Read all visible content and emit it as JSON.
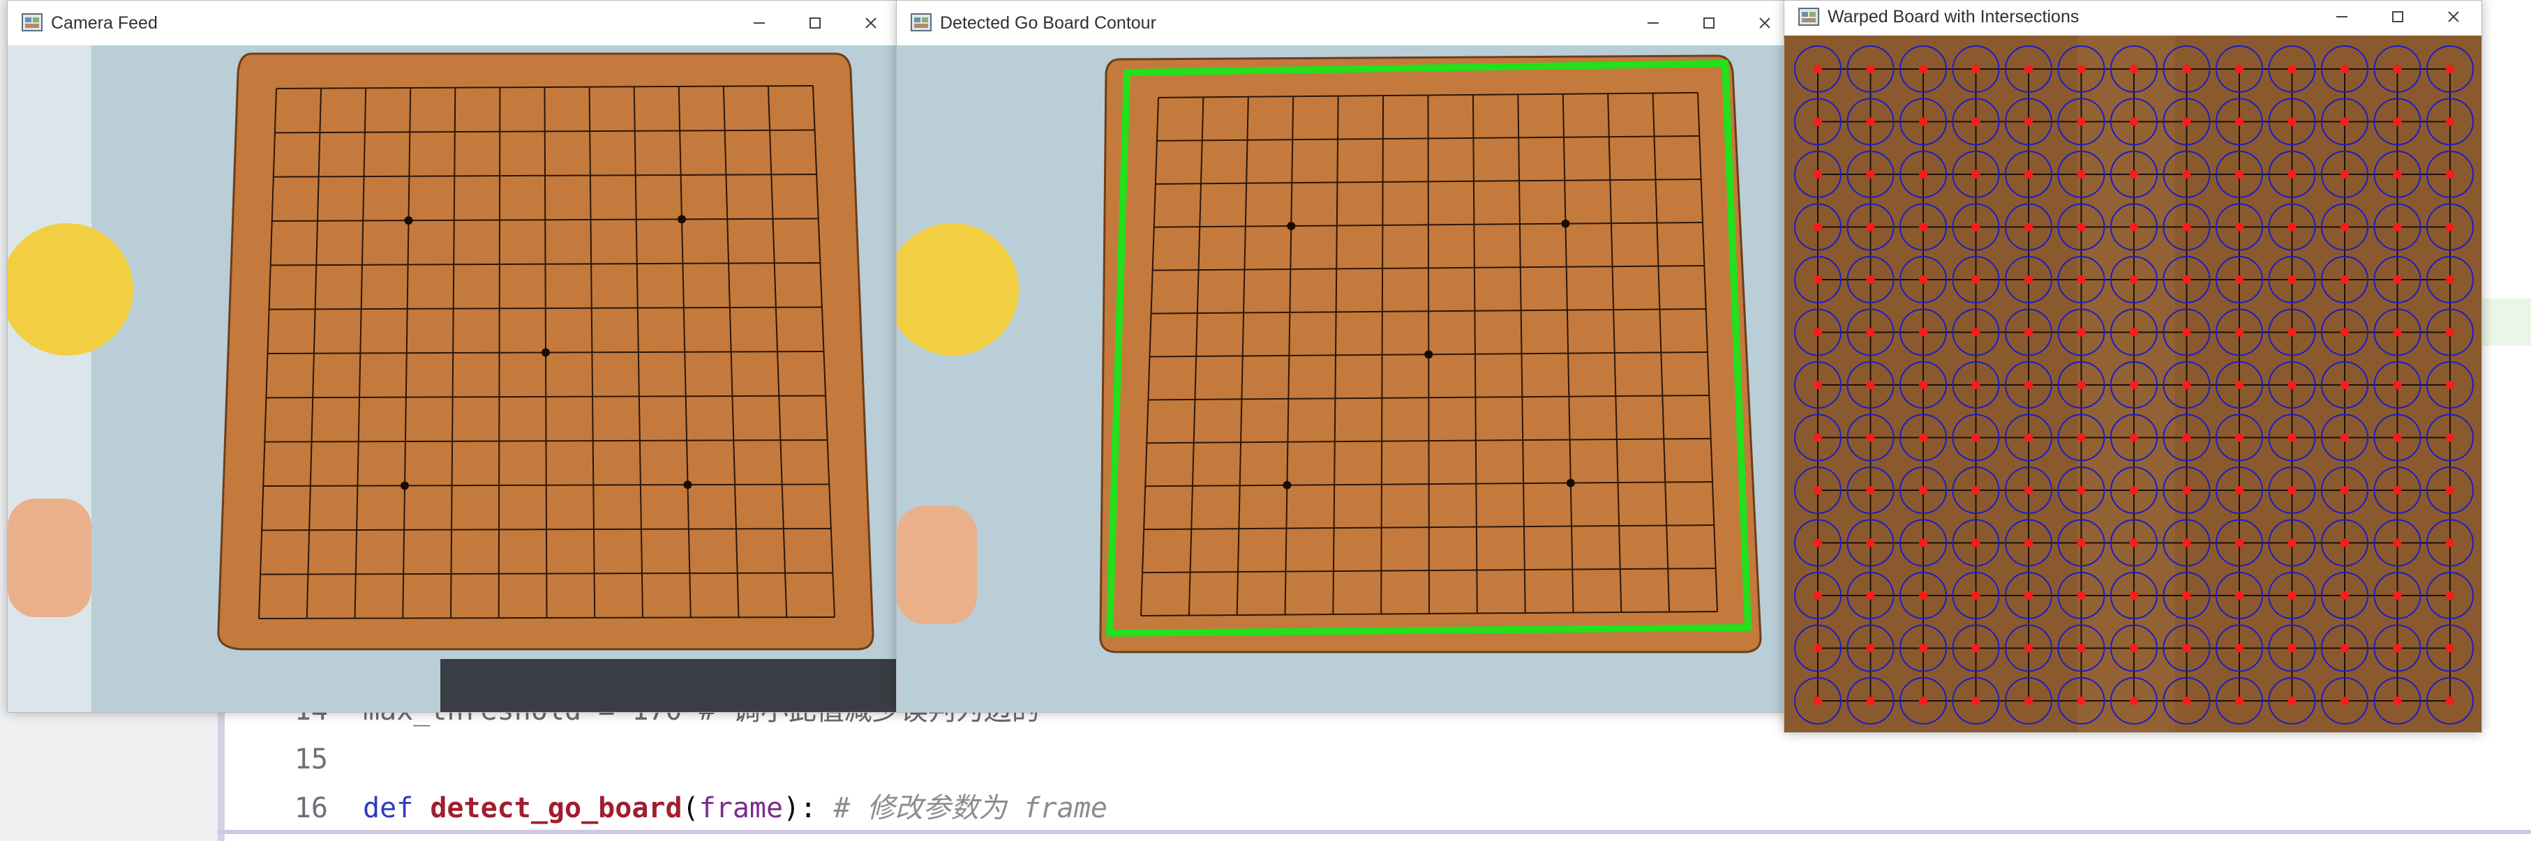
{
  "windows": {
    "camera": {
      "title": "Camera Feed",
      "icon": "opencv-window-icon"
    },
    "contour": {
      "title": "Detected Go Board Contour",
      "icon": "opencv-window-icon"
    },
    "warped": {
      "title": "Warped Board with Intersections",
      "icon": "opencv-window-icon"
    }
  },
  "titlebar_buttons": {
    "minimize": "minimize-icon",
    "maximize": "maximize-icon",
    "close": "close-icon"
  },
  "board": {
    "grid_lines": 13,
    "star_points": 5,
    "intersections_detected": 169
  },
  "code": {
    "lines": [
      {
        "number": "14",
        "text": "max_threshold = 170 # 调小此值减少误判为边的",
        "partial": true
      },
      {
        "number": "15",
        "text": ""
      },
      {
        "number": "16",
        "keyword": "def",
        "function": "detect_go_board",
        "params": "frame",
        "punct_open": "(",
        "punct_close": "):",
        "comment": "# 修改参数为 frame"
      }
    ]
  },
  "colors": {
    "board": "#c47a3c",
    "contour": "#22e01c",
    "intersection_dot": "#ff1a1a",
    "intersection_circle": "#1c1cc8",
    "warped_board": "#8a5a2e",
    "table": "#b7cdd6"
  }
}
